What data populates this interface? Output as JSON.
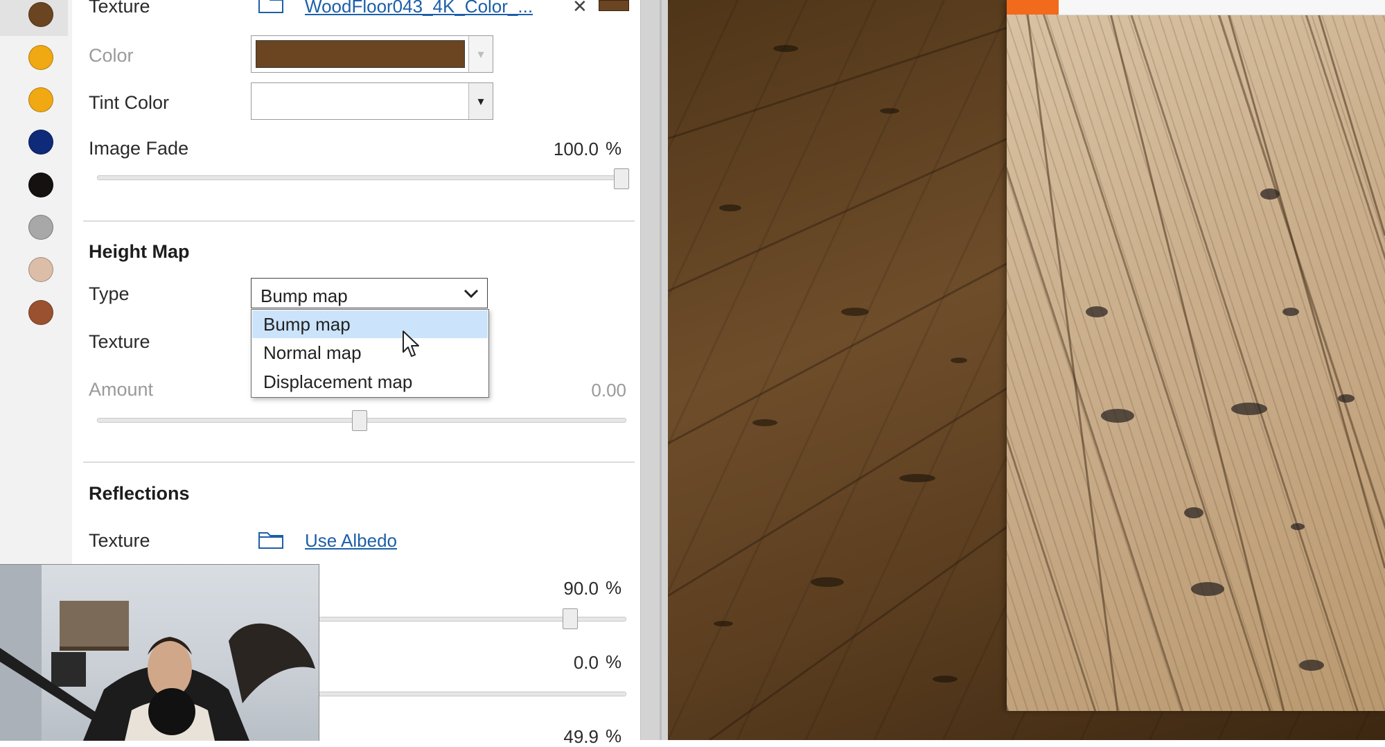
{
  "swatches": [
    {
      "color": "#6b4422"
    },
    {
      "color": "#f0a813"
    },
    {
      "color": "#f0a813"
    },
    {
      "color": "#0e2a78"
    },
    {
      "color": "#141110"
    },
    {
      "color": "#a8a8a8"
    },
    {
      "color": "#dcbda7"
    },
    {
      "color": "#9a5130"
    }
  ],
  "albedo": {
    "texture_label": "Texture",
    "texture_file": "WoodFloor043_4K_Color_...",
    "color_label": "Color",
    "color_value": "#6b4422",
    "tint_label": "Tint Color",
    "image_fade_label": "Image Fade",
    "image_fade_value": "100.0",
    "image_fade_unit": "%",
    "image_fade_level": 1.0
  },
  "height_map": {
    "title": "Height Map",
    "type_label": "Type",
    "type_value": "Bump map",
    "type_options": [
      "Bump map",
      "Normal map",
      "Displacement map"
    ],
    "texture_label": "Texture",
    "amount_label": "Amount",
    "amount_value": "0.00",
    "amount_level": 0.5
  },
  "reflections": {
    "title": "Reflections",
    "texture_label": "Texture",
    "texture_link": "Use Albedo",
    "value1": "90.0",
    "value1_unit": "%",
    "value1_level": 0.9,
    "value2": "0.0",
    "value2_unit": "%",
    "value2_level": 0.0,
    "value3": "49.9",
    "value3_unit": "%"
  },
  "colors": {
    "accent_orange": "#f26a1b",
    "link_blue": "#1c5fa8",
    "dropdown_highlight": "#cce4fb"
  }
}
